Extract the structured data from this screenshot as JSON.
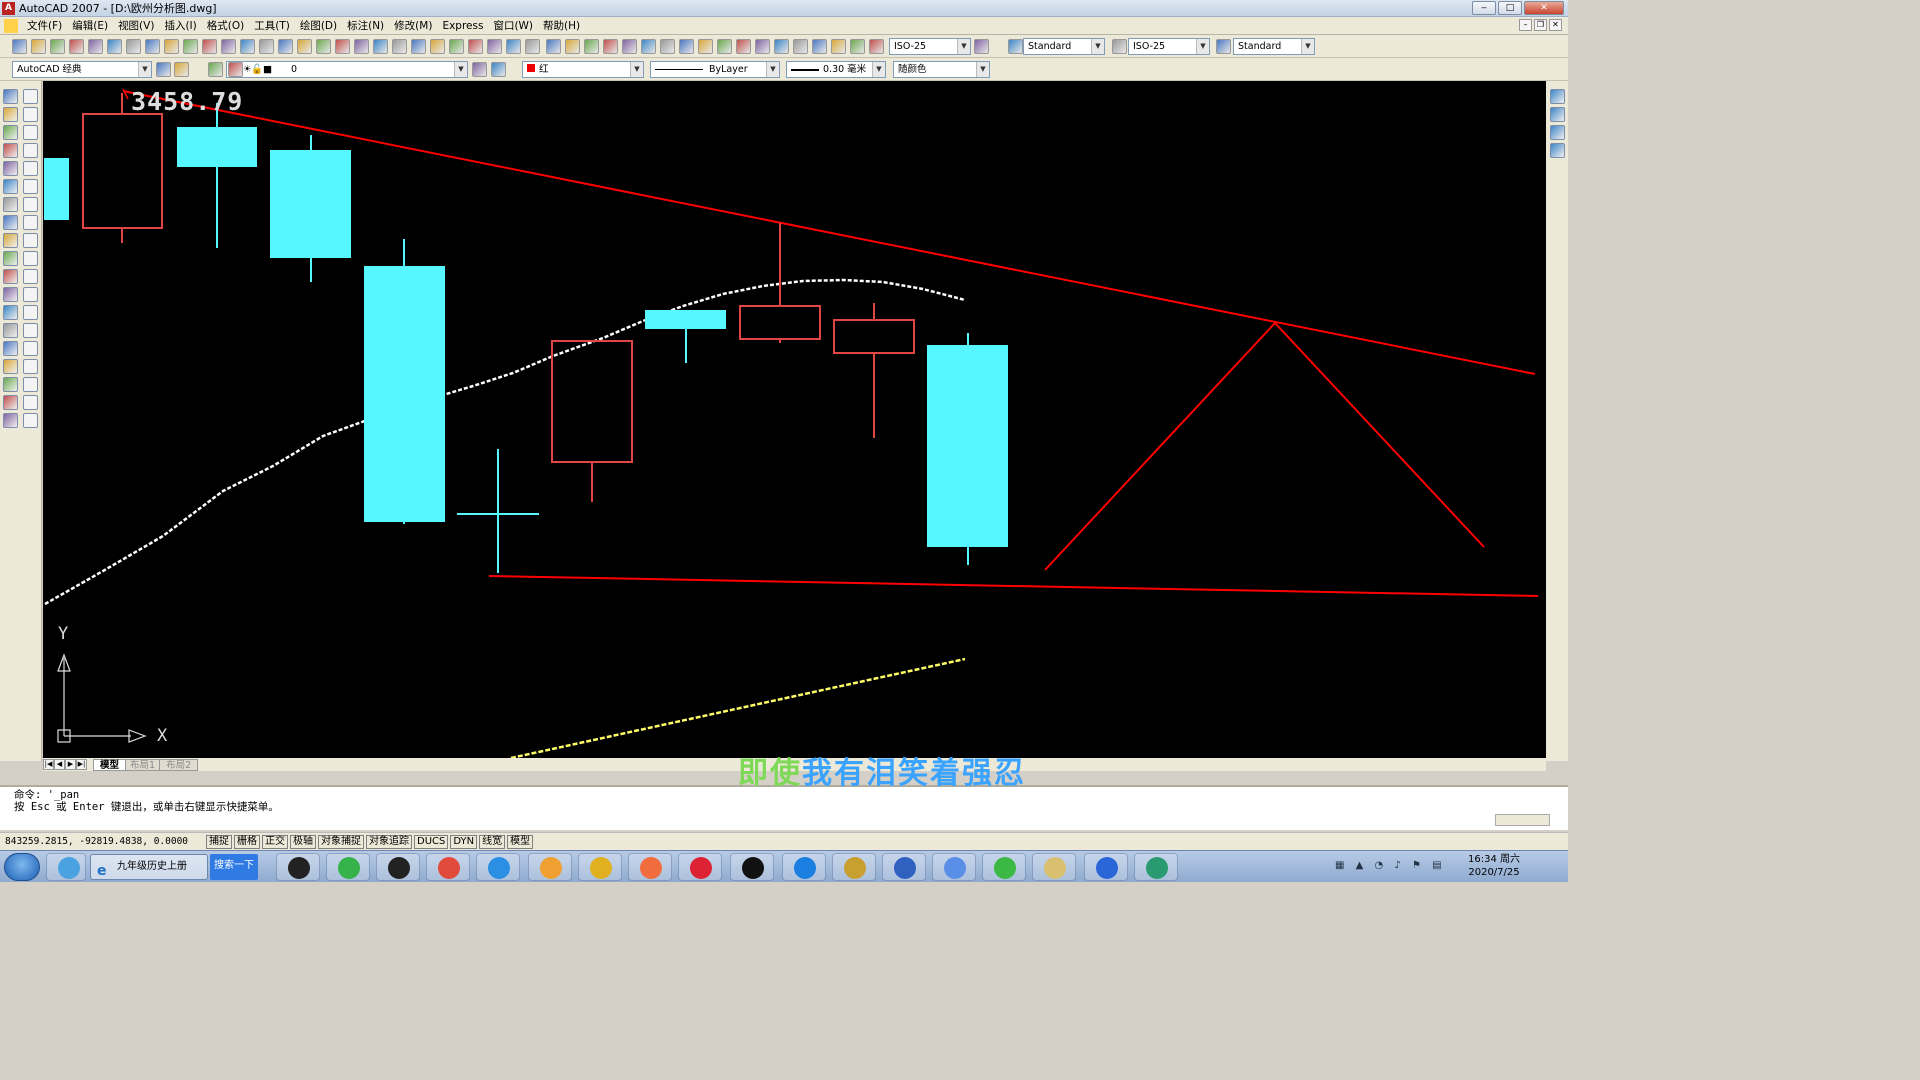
{
  "window": {
    "title": "AutoCAD 2007 - [D:\\欧州分析图.dwg]",
    "minimize": "‒",
    "maximize": "□",
    "close": "✕"
  },
  "menu": [
    "文件(F)",
    "编辑(E)",
    "视图(V)",
    "插入(I)",
    "格式(O)",
    "工具(T)",
    "绘图(D)",
    "标注(N)",
    "修改(M)",
    "Express",
    "窗口(W)",
    "帮助(H)"
  ],
  "toolbar": {
    "dimstyle": "ISO-25",
    "textstyle": "Standard",
    "dimstyle2": "ISO-25",
    "tablestyle": "Standard",
    "workspace": "AutoCAD 经典",
    "layer": "0",
    "color": "红",
    "linetype": "ByLayer",
    "lineweight": "0.30 毫米",
    "plotstyle": "随颜色"
  },
  "canvas": {
    "coord_readout": "3458.79",
    "axis_y": "Y",
    "axis_x": "X",
    "colors": {
      "bull": "#e04646",
      "bear": "#57f7ff",
      "trend": "#ff0000",
      "ma": "#ffffff",
      "ma2": "#ffff66"
    }
  },
  "layout_tabs": [
    "模型",
    "布局1",
    "布局2"
  ],
  "watermark": {
    "text_green": "即使",
    "text_blue": "我有泪笑着强忍",
    "color_green": "#7ed957",
    "color_blue": "#3aa3ff"
  },
  "command": {
    "line1": "命令: '_pan",
    "line2": "按 Esc 或 Enter 键退出，或单击右键显示快捷菜单。"
  },
  "status": {
    "coords": "843259.2815, -92819.4838, 0.0000",
    "buttons": [
      "捕捉",
      "栅格",
      "正交",
      "极轴",
      "对象捕捉",
      "对象追踪",
      "DUCS",
      "DYN",
      "线宽",
      "模型"
    ]
  },
  "taskbar": {
    "ie_label": "九年级历史上册",
    "search_label": "搜索一下",
    "clock_time": "16:34 周六",
    "clock_date": "2020/7/25"
  }
}
